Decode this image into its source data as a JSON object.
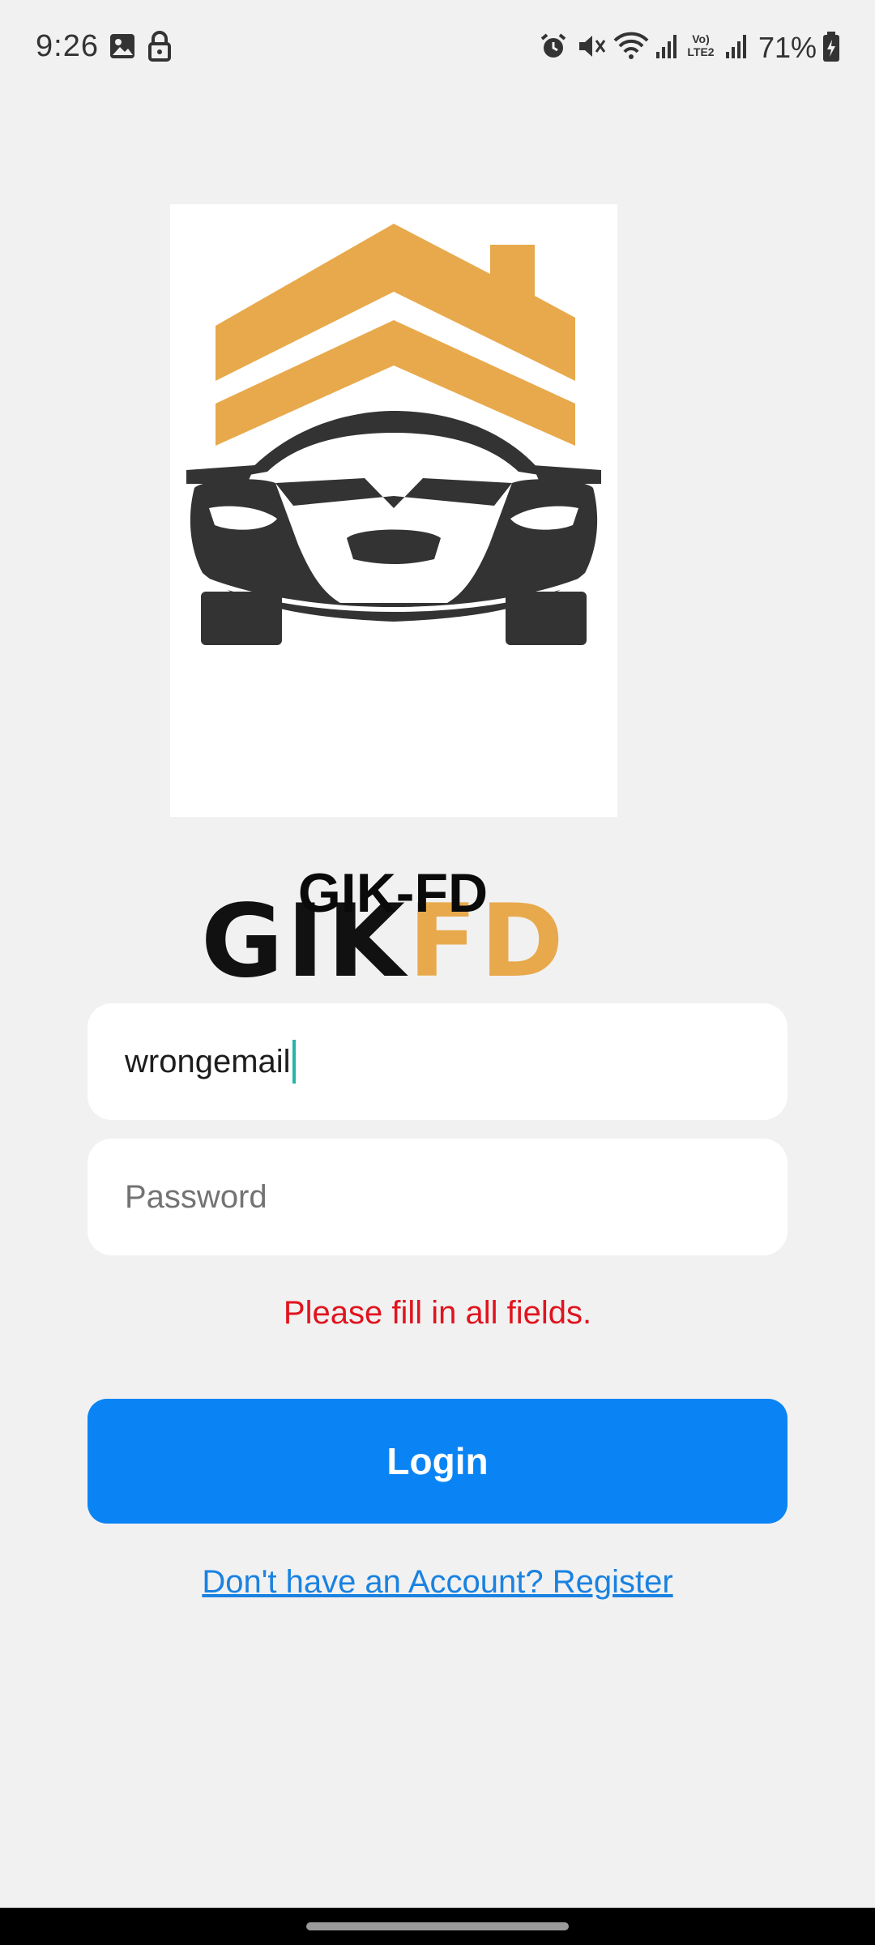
{
  "status_bar": {
    "time": "9:26",
    "battery": "71%",
    "network_label": "Vo) LTE2",
    "icons": [
      "gallery-icon",
      "lock-icon",
      "alarm-icon",
      "mute-icon",
      "wifi-icon",
      "signal-icon",
      "signal-icon",
      "battery-charging-icon"
    ]
  },
  "logo": {
    "text_dark": "GIK",
    "text_accent": "FD",
    "accent_color": "#e8a94c",
    "dark_color": "#333333"
  },
  "app": {
    "title": "GIK-FD"
  },
  "form": {
    "email_value": "wrongemail",
    "password_placeholder": "Password",
    "error_message": "Please fill in all fields.",
    "login_label": "Login",
    "register_link": "Don't have an Account? Register"
  },
  "colors": {
    "button": "#0a84f5",
    "error": "#e0141e",
    "link": "#1a82e0",
    "background": "#f1f1f1"
  }
}
